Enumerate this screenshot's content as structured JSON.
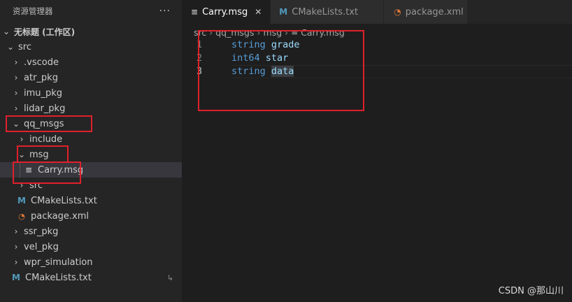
{
  "explorer": {
    "title": "资源管理器",
    "more": "···",
    "workspace": "无标题 (工作区)",
    "items": [
      {
        "label": "src"
      },
      {
        "label": ".vscode"
      },
      {
        "label": "atr_pkg"
      },
      {
        "label": "imu_pkg"
      },
      {
        "label": "lidar_pkg"
      },
      {
        "label": "qq_msgs"
      },
      {
        "label": "include"
      },
      {
        "label": "msg"
      },
      {
        "label": "Carry.msg"
      },
      {
        "label": "src"
      },
      {
        "label": "CMakeLists.txt"
      },
      {
        "label": "package.xml"
      },
      {
        "label": "ssr_pkg"
      },
      {
        "label": "vel_pkg"
      },
      {
        "label": "wpr_simulation"
      },
      {
        "label": "CMakeLists.txt"
      }
    ]
  },
  "tabs": [
    {
      "label": "Carry.msg",
      "active": true
    },
    {
      "label": "CMakeLists.txt"
    },
    {
      "label": "package.xml"
    }
  ],
  "breadcrumb": [
    "src",
    "qq_msgs",
    "msg",
    "Carry.msg"
  ],
  "code": [
    {
      "num": "1",
      "type": "string",
      "name": "grade"
    },
    {
      "num": "2",
      "type": "int64",
      "name": "star"
    },
    {
      "num": "3",
      "type": "string",
      "name": "data"
    }
  ],
  "watermark": "CSDN @那山川",
  "colors": {
    "highlight_box": "#e0202a",
    "keyword": "#569cd6",
    "identifier": "#9cdcfe"
  }
}
